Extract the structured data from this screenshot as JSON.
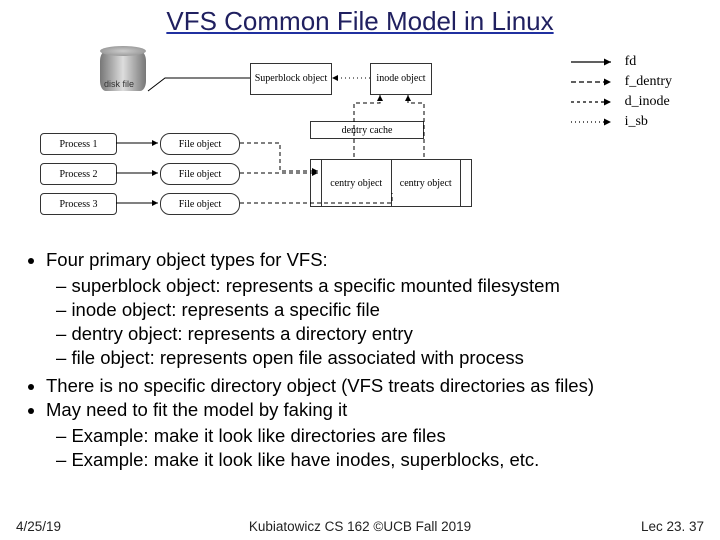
{
  "title": "VFS Common File Model in Linux",
  "diagram": {
    "disk_label": "disk file",
    "proc1": "Process 1",
    "proc2": "Process 2",
    "proc3": "Process 3",
    "fobj1": "File object",
    "fobj2": "File object",
    "fobj3": "File object",
    "superblock": "Superblock object",
    "inode": "inode object",
    "dentry_cache": "dentry cache",
    "centry1": "centry object",
    "centry2": "centry object"
  },
  "legend": {
    "fd": "fd",
    "f_dentry": "f_dentry",
    "d_inode": "d_inode",
    "i_sb": "i_sb"
  },
  "bullets": {
    "b1": "Four primary object types for VFS:",
    "b1a": "superblock object: represents a specific mounted filesystem",
    "b1b": "inode object: represents a specific file",
    "b1c": "dentry object: represents a directory entry",
    "b1d": "file object: represents open file associated with process",
    "b2": "There is no specific directory object (VFS treats directories as files)",
    "b3": "May need to fit the model by faking it",
    "b3a": "Example: make it look like directories are files",
    "b3b": "Example: make it look like have inodes, superblocks, etc."
  },
  "footer": {
    "left": "4/25/19",
    "center": "Kubiatowicz CS 162 ©UCB Fall 2019",
    "right": "Lec 23. 37"
  }
}
